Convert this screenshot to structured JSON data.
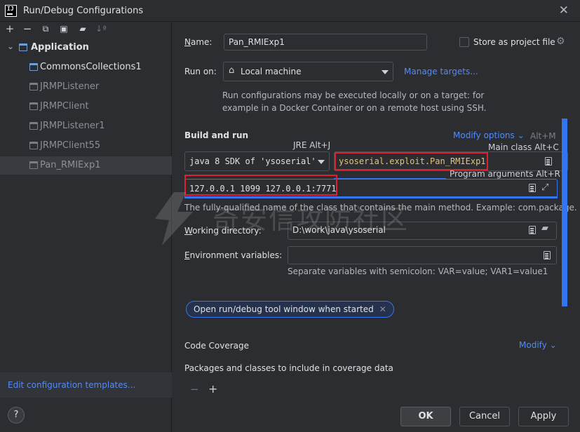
{
  "window": {
    "title": "Run/Debug Configurations",
    "logo": "IJ"
  },
  "toolbar": {
    "add_icon": "plus-icon",
    "remove_icon": "minus-icon",
    "copy_icon": "copy-icon",
    "save_icon": "save-icon",
    "folder_icon": "folder-icon",
    "sort_icon": "sort-icon"
  },
  "tree": {
    "group": "Application",
    "items": [
      {
        "label": "CommonsCollections1"
      },
      {
        "label": "JRMPListener"
      },
      {
        "label": "JRMPClient"
      },
      {
        "label": "JRMPListener1"
      },
      {
        "label": "JRMPClient55"
      },
      {
        "label": "Pan_RMIExp1"
      }
    ]
  },
  "left_footer": {
    "edit_templates": "Edit configuration templates..."
  },
  "form": {
    "name_label_u": "N",
    "name_label_rest": "ame:",
    "name_value": "Pan_RMIExp1",
    "store_label": "Store as project file",
    "run_on_label": "Run on:",
    "run_on_value": "Local machine",
    "manage_targets": "Manage targets...",
    "run_on_help_line1": "Run configurations may be executed locally or on a target: for",
    "run_on_help_line2": "example in a Docker Container or on a remote host using SSH.",
    "build_run_heading": "Build and run",
    "modify_options": "Modify options",
    "modify_options_shortcut": "Alt+M",
    "jre_hint": "JRE Alt+J",
    "main_class_hint": "Main class Alt+C",
    "sdk_value": "java 8 SDK of 'ysoserial'",
    "main_class_value": "ysoserial.exploit.Pan_RMIExp1",
    "program_args_hint": "Program arguments Alt+R",
    "program_args_value": "127.0.0.1 1099 127.0.0.1:7771",
    "main_class_help": "The fully-qualified name of the class that contains the main method. Example: com.package.",
    "working_dir_label_u": "W",
    "working_dir_label_rest": "orking directory:",
    "working_dir_value": "D:\\work\\java\\ysoserial",
    "env_label_u": "E",
    "env_label_rest": "nvironment variables:",
    "env_value": "",
    "env_help": "Separate variables with semicolon: VAR=value; VAR1=value1",
    "open_tool_window_pill": "Open run/debug tool window when started",
    "code_coverage_heading": "Code Coverage",
    "modify_link": "Modify",
    "coverage_packages": "Packages and classes to include in coverage data"
  },
  "buttons": {
    "ok": "OK",
    "cancel": "Cancel",
    "apply": "Apply",
    "help": "?"
  },
  "watermark": {
    "text": "奇安信攻防社区"
  },
  "colors": {
    "accent": "#3574f0",
    "link": "#548af7",
    "annotation_red": "#e02030"
  }
}
